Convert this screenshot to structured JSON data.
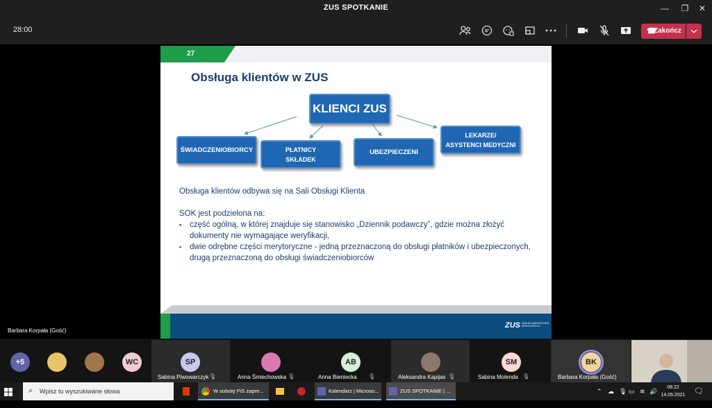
{
  "window": {
    "title": "ZUS SPOTKANIE"
  },
  "toolbar": {
    "timer": "28:00",
    "end_label": "Zakończ"
  },
  "slide": {
    "number": "27",
    "title": "Obsługa klientów w ZUS",
    "diagram": {
      "center": "KLIENCI ZUS",
      "nodes": [
        {
          "line1": "ŚWIADCZENIOBIORCY",
          "line2": ""
        },
        {
          "line1": "PŁATNICY",
          "line2": "SKŁADEK"
        },
        {
          "line1": "UBEZPIECZENI",
          "line2": ""
        },
        {
          "line1": "LEKARZE/",
          "line2": "ASYSTENCI MEDYCZNI"
        }
      ]
    },
    "intro": "Obsługa klientów odbywa się na Sali Obsługi Klienta",
    "sok": "SOK jest podzielona na:",
    "bullet1": "część ogólną, w której znajduje się stanowisko „Dziennik podawczy”, gdzie można złożyć dokumenty nie wymagające weryfikacji,",
    "bullet2": "dwie odrębne części merytoryczne - jedną przeznaczoną do obsługi płatników i ubezpieczonych, drugą przeznaczoną do obsługi świadczeniobiorców",
    "logo": "ZUS",
    "logo_sub": "ZAKŁAD UBEZPIECZEŃ SPOŁECZNYCH"
  },
  "presenter": "Barbara Korpała (Gość)",
  "participants": {
    "more": "+5",
    "initials_wc": "WC",
    "tiles": [
      {
        "initials": "SP",
        "name": "Sabina Piwowarczyk"
      },
      {
        "initials": "",
        "name": "Anna Śmiechowska"
      },
      {
        "initials": "AB",
        "name": "Anna Bieniecka"
      },
      {
        "initials": "",
        "name": "Aleksandra Kapijas"
      },
      {
        "initials": "SM",
        "name": "Sabina Molenda"
      },
      {
        "initials": "BK",
        "name": "Barbara Korpała (Gość)"
      }
    ]
  },
  "taskbar": {
    "search_placeholder": "Wpisz tu wyszukiwane słowa",
    "apps": [
      {
        "label": "W sobotę PiS zapre..."
      },
      {
        "label": "Kalendarz | Microso..."
      },
      {
        "label": "ZUS SPOTKANIE | ..."
      }
    ],
    "time": "08:22",
    "date": "14.05.2021"
  },
  "colors": {
    "end_red": "#c4314b",
    "slide_green": "#1f9c4a",
    "slide_blue": "#1f67b2",
    "title_navy": "#1a3e6f"
  }
}
